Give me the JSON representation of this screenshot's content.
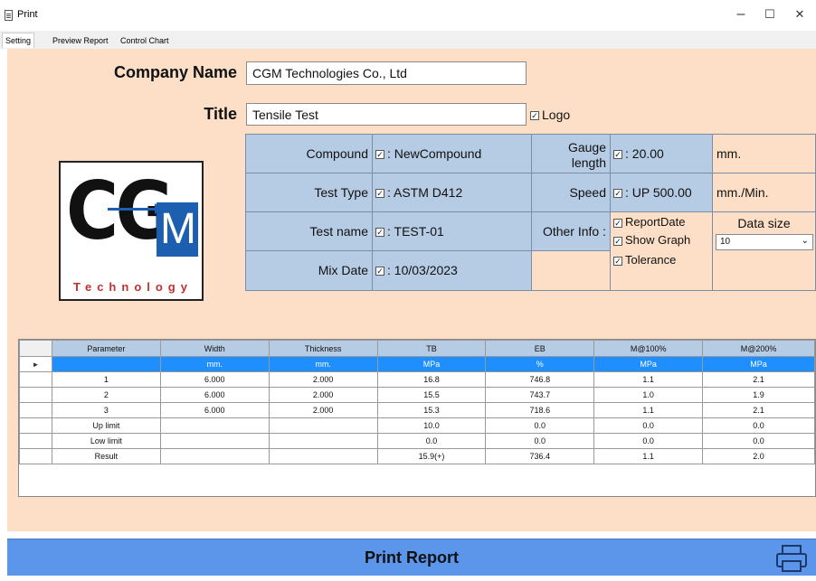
{
  "window": {
    "title": "Print",
    "minimize": "–",
    "maximize": "☐",
    "close": "✕"
  },
  "tabs": [
    {
      "label": "Setting"
    },
    {
      "label": "Preview Report"
    },
    {
      "label": "Control Chart"
    }
  ],
  "header": {
    "company_label": "Company Name",
    "company_value": "CGM Technologies Co., Ltd",
    "title_label": "Title",
    "title_value": "Tensile Test",
    "logo_label": "Logo",
    "logo_checked": true
  },
  "logo": {
    "letters": "CG",
    "m": "M",
    "tagline": "Technology"
  },
  "info": {
    "compound_label": "Compound",
    "compound_value": ": NewCompound",
    "test_type_label": "Test Type",
    "test_type_value": ": ASTM D412",
    "test_name_label": "Test name",
    "test_name_value": ": TEST-01",
    "mix_date_label": "Mix Date",
    "mix_date_value": ": 10/03/2023",
    "gauge_label_1": "Gauge",
    "gauge_label_2": "length",
    "gauge_value": ": 20.00",
    "gauge_unit": "mm.",
    "speed_label": "Speed",
    "speed_value": ": UP 500.00",
    "speed_unit": "mm./Min.",
    "other_info_label": "Other Info :",
    "report_date_label": "ReportDate",
    "show_graph_label": "Show Graph",
    "tolerance_label": "Tolerance",
    "data_size_label": "Data size",
    "data_size_value": "10"
  },
  "table": {
    "headers": [
      "Parameter",
      "Width",
      "Thickness",
      "TB",
      "EB",
      "M@100%",
      "M@200%"
    ],
    "units": [
      "",
      "mm.",
      "mm.",
      "MPa",
      "%",
      "MPa",
      "MPa"
    ],
    "rows": [
      [
        "1",
        "6.000",
        "2.000",
        "16.8",
        "746.8",
        "1.1",
        "2.1"
      ],
      [
        "2",
        "6.000",
        "2.000",
        "15.5",
        "743.7",
        "1.0",
        "1.9"
      ],
      [
        "3",
        "6.000",
        "2.000",
        "15.3",
        "718.6",
        "1.1",
        "2.1"
      ],
      [
        "Up limit",
        "",
        "",
        "10.0",
        "0.0",
        "0.0",
        "0.0"
      ],
      [
        "Low limit",
        "",
        "",
        "0.0",
        "0.0",
        "0.0",
        "0.0"
      ],
      [
        "Result",
        "",
        "",
        "15.9(+)",
        "736.4",
        "1.1",
        "2.0"
      ]
    ],
    "row_marker": "►"
  },
  "print_button": {
    "label": "Print Report"
  },
  "colors": {
    "panel": "#fcdfc6",
    "cell_blue": "#b6cbe4",
    "selected_row": "#1f8fff",
    "print_bar": "#5b96ea"
  }
}
